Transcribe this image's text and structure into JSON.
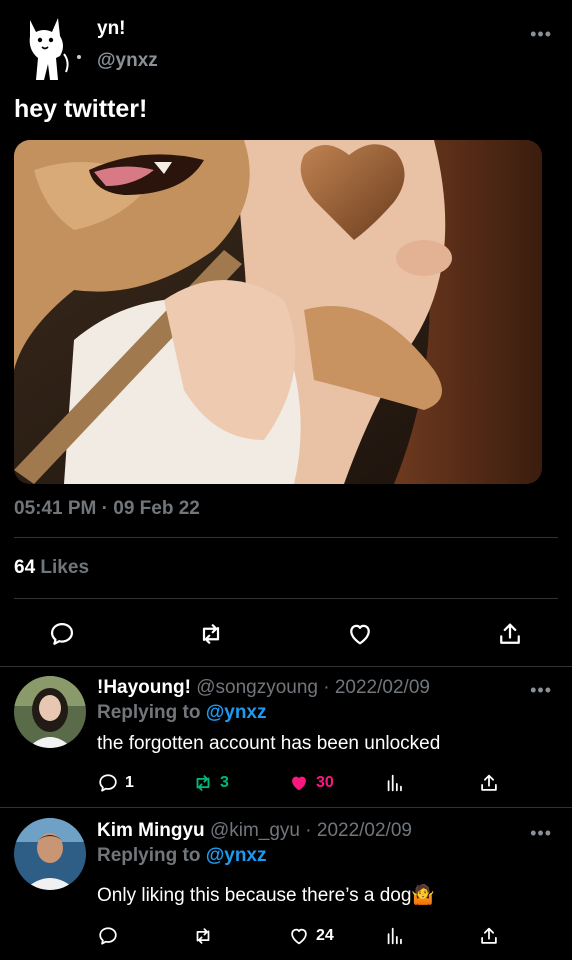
{
  "tweet": {
    "author_name": "yn!",
    "author_handle": "@ynxz",
    "text": "hey twitter!",
    "timestamp": "05:41 PM · 09 Feb 22",
    "likes_count": "64",
    "likes_label": "Likes",
    "more": "•••"
  },
  "replies": [
    {
      "name": "!Hayoung!",
      "handle_date": "@songzyoung · 2022/02/09",
      "replying_prefix": "Replying to",
      "replying_to": "@ynxz",
      "text": "the forgotten account has been unlocked",
      "reply_count": "1",
      "retweet_count": "3",
      "like_count": "30",
      "liked": true,
      "retweeted": true
    },
    {
      "name": "Kim Mingyu",
      "handle_date": "@kim_gyu · 2022/02/09",
      "replying_prefix": "Replying to",
      "replying_to": "@ynxz",
      "text": "Only liking this because there’s a dog🤷",
      "reply_count": "",
      "retweet_count": "",
      "like_count": "24",
      "liked": false,
      "retweeted": false
    }
  ],
  "colors": {
    "background": "#000000",
    "muted": "#71767b",
    "link": "#1d9bf0",
    "like": "#f91880",
    "retweet": "#00ba7c"
  },
  "icons": [
    "reply-icon",
    "retweet-icon",
    "heart-icon",
    "share-icon",
    "analytics-icon",
    "more-icon"
  ]
}
